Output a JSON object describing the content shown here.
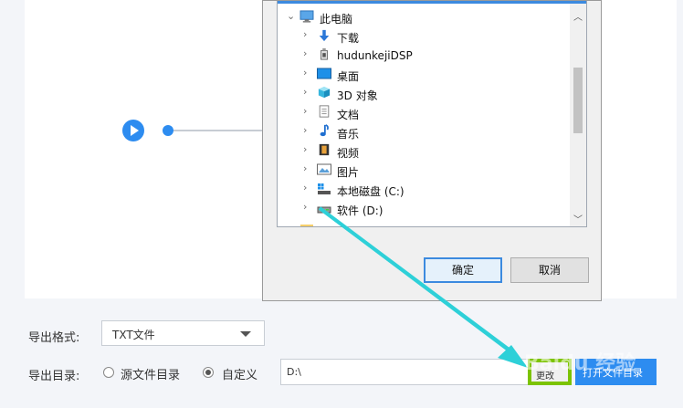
{
  "dialog": {
    "tree_items": [
      {
        "label": "此电脑",
        "icon": "computer-icon",
        "expanded": true
      },
      {
        "label": "下载",
        "icon": "download-arrow-icon"
      },
      {
        "label": "hudunkejiDSP",
        "icon": "usb-drive-icon"
      },
      {
        "label": "桌面",
        "icon": "desktop-icon"
      },
      {
        "label": "3D 对象",
        "icon": "cube-icon"
      },
      {
        "label": "文档",
        "icon": "document-icon"
      },
      {
        "label": "音乐",
        "icon": "music-note-icon"
      },
      {
        "label": "视频",
        "icon": "film-icon"
      },
      {
        "label": "图片",
        "icon": "picture-icon"
      },
      {
        "label": "本地磁盘 (C:)",
        "icon": "windows-drive-icon"
      },
      {
        "label": "软件 (D:)",
        "icon": "drive-icon"
      }
    ],
    "partial_item_label": "...",
    "ok_label": "确定",
    "cancel_label": "取消"
  },
  "export": {
    "format_label": "导出格式:",
    "format_value": "TXT文件",
    "dir_label": "导出目录:",
    "radio_source_label": "源文件目录",
    "radio_custom_label": "自定义",
    "selected_radio": "custom",
    "dir_value": "D:\\",
    "change_label": "更改",
    "open_label": "打开文件目录"
  },
  "watermark": "Baidu 经验",
  "colors": {
    "accent": "#2d8cf0",
    "highlight_box": "#7cc300",
    "annotation_arrow": "#2ed0d8"
  }
}
